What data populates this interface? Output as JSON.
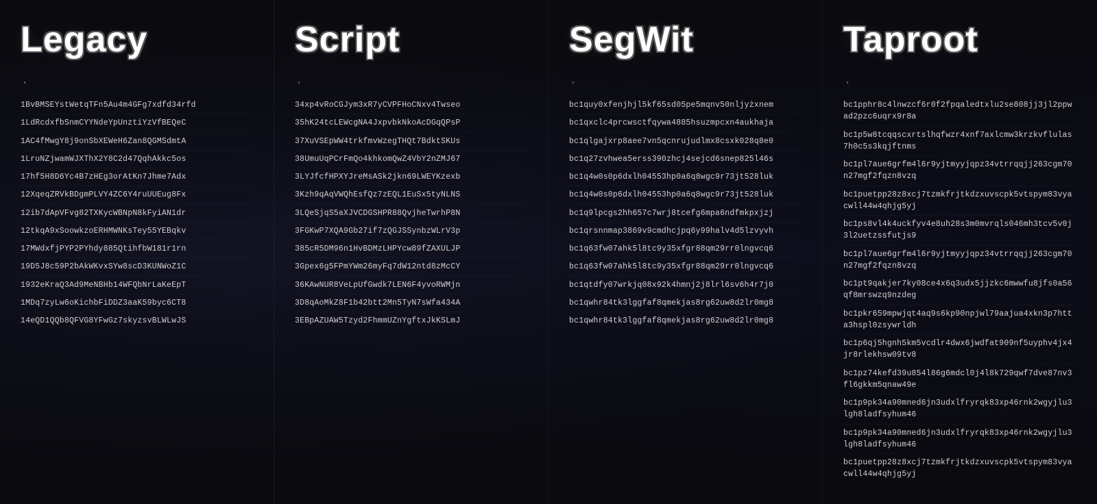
{
  "columns": [
    {
      "id": "legacy",
      "title": "Legacy",
      "addresses": [
        "1BvBMSEYstWetqTFn5Au4m4GFg7xdfd34rfd",
        "1LdRcdxfbSnmCYYNdeYpUnztiYzVfBEQeC",
        "1AC4fMwgY8j9onSbXEWeH6Zan8QGMSdmtA",
        "1LruNZjwamWJXThX2Y8C2d47QqhAkkc5os",
        "17hf5H8D6Yc4B7zHEg3orAtKn7Jhme7Adx",
        "12XqeqZRVkBDgmPLVY4ZC6Y4ruUUEug8Fx",
        "12ib7dApVFvg82TXKycWBNpN8kFyiAN1dr",
        "12tkqA9xSoowkzoERHMWNKsTey55YEBqkv",
        "17MWdxfjPYP2PYhdy885QtihfbW181r1rn",
        "19D5J8c59P2bAkWKvxSYw8scD3KUNWoZ1C",
        "1932eKraQ3Ad9MeNBHb14WFQbNrLaKeEpT",
        "1MDq7zyLw6oKichbFiDDZ3aaK59byc6CT8",
        "14eQD1QQb8QFVG8YFwGz7skyzsvBLWLwJS"
      ]
    },
    {
      "id": "script",
      "title": "Script",
      "addresses": [
        "34xp4vRoCGJym3xR7yCVPFHoCNxv4Twseo",
        "35hK24tcLEWcgNA4JxpvbkNkoAcDGqQPsP",
        "37XuVSEpWW4trkfmvWzegTHQt7BdktSKUs",
        "38UmuUqPCrFmQo4khkomQwZ4VbY2nZMJ67",
        "3LYJfcfHPXYJreMsASk2jkn69LWEYKzexb",
        "3Kzh9qAqVWQhEsfQz7zEQL1EuSx5tyNLNS",
        "3LQeSjqS5aXJVCDGSHPR88QvjheTwrhP8N",
        "3FGKwP7XQA9Gb27if7zQGJSSynbzWLrV3p",
        "385cR5DM96n1HvBDMzLHPYcw89fZAXULJP",
        "3Gpex6g5FPmYWm26myFq7dW12ntd8zMcCY",
        "36KAwNUR8VeLpUfGwdk7LEN6F4yvoRWMjn",
        "3D8qAoMkZ8F1b42btt2Mn5TyN7sWfa434A",
        "3EBpAZUAW5Tzyd2FhmmUZnYgftxJkKSLmJ"
      ]
    },
    {
      "id": "segwit",
      "title": "SegWit",
      "addresses": [
        "bc1quy0xfenjhjl5kf65sd05pe5mqnv50nljyżxnem",
        "bc1qxclc4prcwsctfqywa4885hsuzmpcxn4aukhaja",
        "bc1qlgajxrp8aee7vn5qcnrujudlmx8csxk028q8e0",
        "bc1q27zvhwea5erss390zhcj4sejcd6snep825l46s",
        "bc1q4w0s0p6dxlh04553hp0a6q8wgc9r73jt528luk",
        "bc1q4w0s0p6dxlh04553hp0a6q8wgc9r73jt528luk",
        "bc1q9lpcgs2hh657c7wrj8tcefg6mpa6ndfmkpxjzj",
        "bc1qrsnnmap3869v9cmdhcjpq6y99halv4d5lzvyvh",
        "bc1q63fw07ahk5l8tc9y35xfgr88qm29rr0lngvcq6",
        "bc1q63fw07ahk5l8tc9y35xfgr88qm29rr0lngvcq6",
        "bc1qtdfy07wrkjq08x92k4hmnj2j8lrl6sv6h4r7j0",
        "bc1qwhr84tk3lggfaf8qmekjas8rg62uw8d2lr0mg8",
        "bc1qwhr84tk3lggfaf8qmekjas8rg62uw8d2lr0mg8"
      ]
    },
    {
      "id": "taproot",
      "title": "Taproot",
      "addresses": [
        "bc1pphr8c4lnwzcf6r0f2fpqaledtxlu2se808jj3jl2ppwad2pzc6uqrx9r8a",
        "bc1p5w8tcqqscxrtslhqfwzr4xnf7axlcmw3krzkvflulas7h0c5s3kqjftnms",
        "bc1pl7aue6grfm4l6r9yjtmyyjqpz34vtrrqqjj263cgm70n27mgf2fqzn8vzq",
        "bc1puetpp28z8xcj7tzmkfrjtkdzxuvscpk5vtspym83vyacwll44w4qhjg5yj",
        "bc1ps8vl4k4uckfyv4e8uh28s3m0mvrqls046mh3tcv5v0j3l2uetzssfutjs9",
        "bc1pl7aue6grfm4l6r9yjtmyyjqpz34vtrrqqjj263cgm70n27mgf2fqzn8vzq",
        "bc1pt9qakjer7ky08ce4x6q3udx5jjzkc6mwwfu8jfs0a56qf8mrswzq9nzdeg",
        "bc1pkr659mpwjqt4aq9s6kp90npjwl79aajua4xkn3p7htta3hspl0zsywrldh",
        "bc1p6qj5hgnh5km5vcdlr4dwx6jwdfat909nf5uyphv4jx4jr8rlekhsw09tv8",
        "bc1pz74kefd39u854l86g6mdcl0j4l8k729qwf7dve87nv3fl6gkkm5qnaw49e",
        "bc1p9pk34a90mned6jn3udxlfryrqk83xp46rnk2wgyjlu3lgh8ladfsyhum46",
        "bc1p9pk34a90mned6jn3udxlfryrqk83xp46rnk2wgyjlu3lgh8ladfsyhum46",
        "bc1puetpp28z8xcj7tzmkfrjtkdzxuvscpk5vtspym83vyacwll44w4qhjg5yj"
      ]
    }
  ]
}
